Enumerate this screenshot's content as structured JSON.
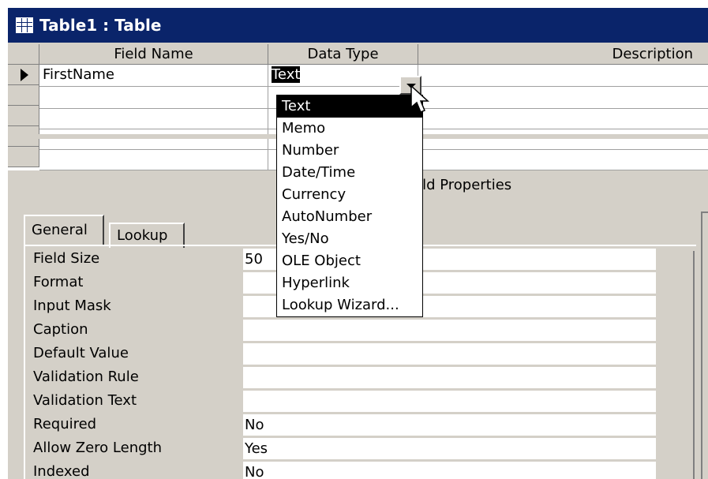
{
  "window": {
    "title": "Table1 : Table"
  },
  "grid": {
    "headers": {
      "field_name": "Field Name",
      "data_type": "Data Type",
      "description": "Description"
    },
    "rows": [
      {
        "field_name": "FirstName",
        "data_type": "Text",
        "description": ""
      }
    ]
  },
  "dropdown": {
    "selected": "Text",
    "options": [
      "Text",
      "Memo",
      "Number",
      "Date/Time",
      "Currency",
      "AutoNumber",
      "Yes/No",
      "OLE Object",
      "Hyperlink",
      "Lookup Wizard..."
    ]
  },
  "field_properties": {
    "label_partial": "eld Properties",
    "tabs": [
      {
        "label": "General"
      },
      {
        "label": "Lookup"
      }
    ],
    "properties": [
      {
        "label": "Field Size",
        "value": "50"
      },
      {
        "label": "Format",
        "value": ""
      },
      {
        "label": "Input Mask",
        "value": ""
      },
      {
        "label": "Caption",
        "value": ""
      },
      {
        "label": "Default Value",
        "value": ""
      },
      {
        "label": "Validation Rule",
        "value": ""
      },
      {
        "label": "Validation Text",
        "value": ""
      },
      {
        "label": "Required",
        "value": "No"
      },
      {
        "label": "Allow Zero Length",
        "value": "Yes"
      },
      {
        "label": "Indexed",
        "value": "No"
      }
    ]
  },
  "colors": {
    "titlebar": "#0a246a",
    "face": "#d4d0c8",
    "selection": "#000000"
  }
}
